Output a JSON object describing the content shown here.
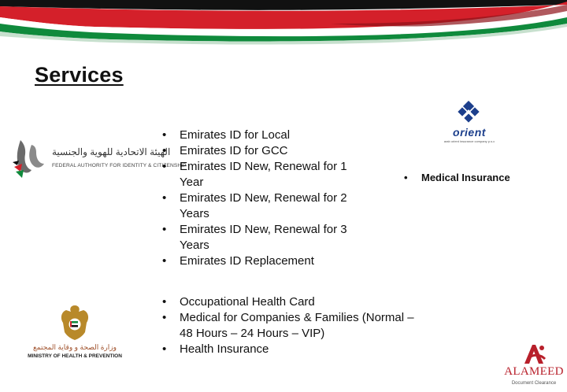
{
  "title": "Services",
  "eida": {
    "logo_ar": "الهيئة الاتحادية للهوية والجنسية",
    "logo_en": "FEDERAL AUTHORITY FOR IDENTITY & CITIZENSHIP",
    "services": [
      "Emirates ID for Local",
      "Emirates ID for GCC",
      "Emirates ID New, Renewal for 1 Year",
      "Emirates ID New, Renewal for 2 Years",
      "Emirates ID New, Renewal for 3 Years",
      "Emirates ID Replacement"
    ]
  },
  "moh": {
    "logo_ar": "وزارة الصحة و وقاية المجتمع",
    "logo_en": "MINISTRY OF HEALTH & PREVENTION",
    "services": [
      "Occupational Health Card",
      "Medical for Companies & Families (Normal – 48 Hours – 24 Hours – VIP)",
      "Health Insurance"
    ]
  },
  "insurance": {
    "logo_name": "orient",
    "logo_tagline": "arab orient insurance company p.s.c",
    "services": [
      "Medical Insurance"
    ]
  },
  "brand": {
    "name": "ALAMEED",
    "tagline": "Document Clearance"
  },
  "colors": {
    "flag_red": "#d4202a",
    "flag_green": "#0f8a3c",
    "flag_black": "#111111",
    "orient_blue": "#1c3f8c",
    "alameed_red": "#b8202b"
  }
}
